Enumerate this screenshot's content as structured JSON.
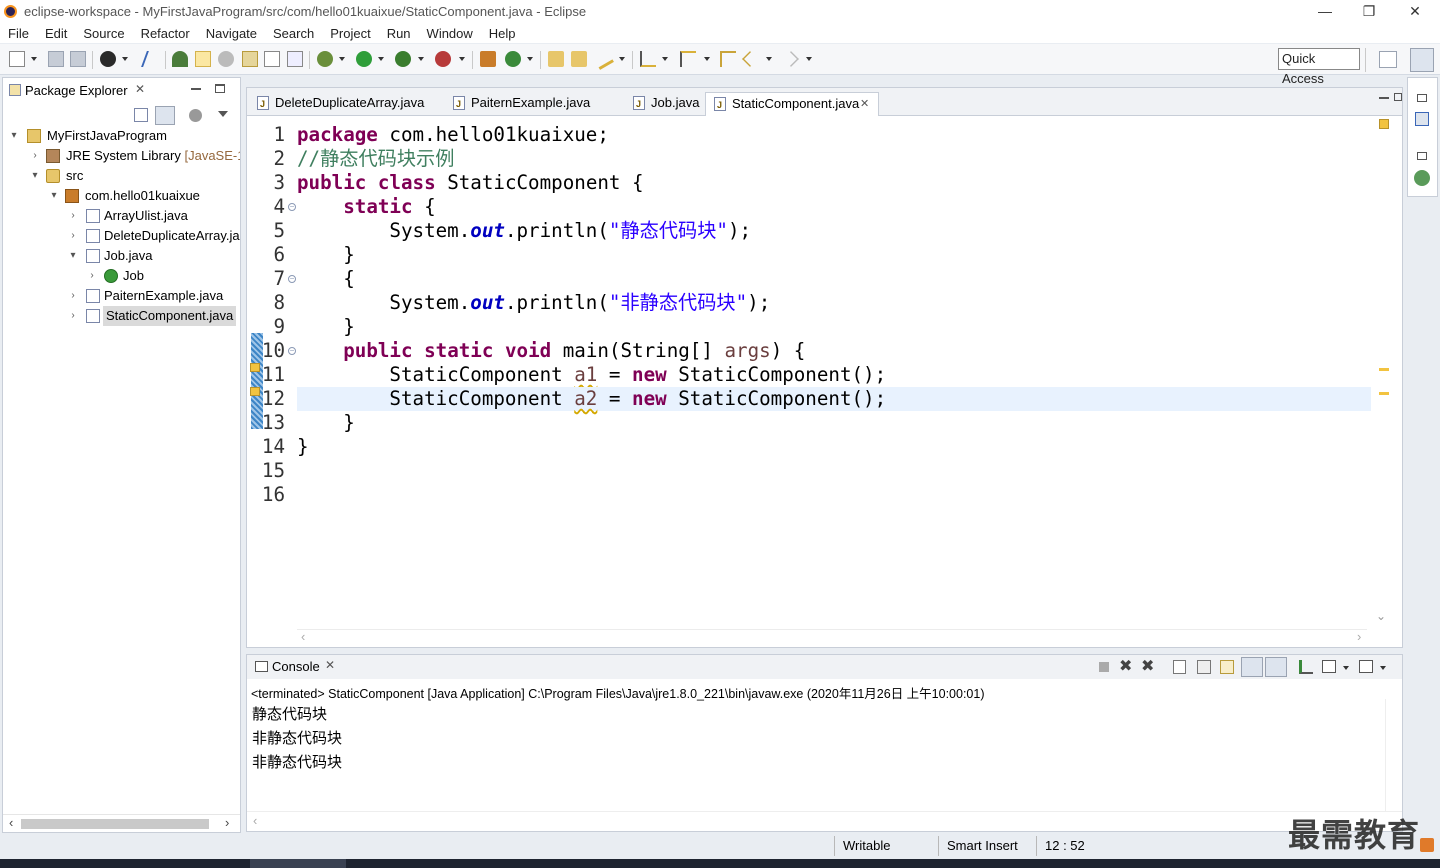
{
  "window": {
    "title": "eclipse-workspace - MyFirstJavaProgram/src/com/hello01kuaixue/StaticComponent.java - Eclipse",
    "minimize": "—",
    "restore": "❐",
    "close": "✕"
  },
  "menu": [
    "File",
    "Edit",
    "Source",
    "Refactor",
    "Navigate",
    "Search",
    "Project",
    "Run",
    "Window",
    "Help"
  ],
  "toolbar": {
    "quick_access": "Quick Access"
  },
  "package_explorer": {
    "title": "Package Explorer",
    "tree": [
      {
        "label": "MyFirstJavaProgram",
        "depth": 0,
        "twisty": "▾",
        "icon": "project-icon"
      },
      {
        "label": "JRE System Library",
        "suffix": " [JavaSE-1.",
        "depth": 1,
        "twisty": "›",
        "icon": "library-icon"
      },
      {
        "label": "src",
        "depth": 1,
        "twisty": "▾",
        "icon": "source-folder-icon"
      },
      {
        "label": "com.hello01kuaixue",
        "depth": 2,
        "twisty": "▾",
        "icon": "package-icon"
      },
      {
        "label": "ArrayUlist.java",
        "depth": 3,
        "twisty": "›",
        "icon": "java-file-icon"
      },
      {
        "label": "DeleteDuplicateArray.ja",
        "depth": 3,
        "twisty": "›",
        "icon": "java-file-icon"
      },
      {
        "label": "Job.java",
        "depth": 3,
        "twisty": "▾",
        "icon": "java-file-icon"
      },
      {
        "label": "Job",
        "depth": 4,
        "twisty": "›",
        "icon": "class-icon"
      },
      {
        "label": "PaiternExample.java",
        "depth": 3,
        "twisty": "›",
        "icon": "java-file-icon"
      },
      {
        "label": "StaticComponent.java",
        "depth": 3,
        "twisty": "›",
        "icon": "java-file-icon",
        "selected": true
      }
    ]
  },
  "editor": {
    "tabs": [
      {
        "label": "DeleteDuplicateArray.java",
        "active": false
      },
      {
        "label": "PaiternExample.java",
        "active": false
      },
      {
        "label": "Job.java",
        "active": false
      },
      {
        "label": "StaticComponent.java",
        "active": true
      }
    ],
    "close_glyph": "✕",
    "current_line": 12,
    "lines": [
      {
        "n": "1",
        "tokens": [
          {
            "t": "package",
            "k": "k"
          },
          {
            "t": " com.hello01kuaixue;",
            "k": "p"
          }
        ]
      },
      {
        "n": "2",
        "tokens": [
          {
            "t": "//静态代码块示例",
            "k": "c"
          }
        ]
      },
      {
        "n": "3",
        "tokens": [
          {
            "t": "public",
            "k": "k"
          },
          {
            "t": " ",
            "k": "p"
          },
          {
            "t": "class",
            "k": "k"
          },
          {
            "t": " StaticComponent {",
            "k": "p"
          }
        ]
      },
      {
        "n": "4",
        "fold": true,
        "tokens": [
          {
            "t": "    ",
            "k": "p"
          },
          {
            "t": "static",
            "k": "k"
          },
          {
            "t": " {",
            "k": "p"
          }
        ]
      },
      {
        "n": "5",
        "tokens": [
          {
            "t": "        System.",
            "k": "p"
          },
          {
            "t": "out",
            "k": "f"
          },
          {
            "t": ".println(",
            "k": "p"
          },
          {
            "t": "\"静态代码块\"",
            "k": "s"
          },
          {
            "t": ");",
            "k": "p"
          }
        ]
      },
      {
        "n": "6",
        "tokens": [
          {
            "t": "    }",
            "k": "p"
          }
        ]
      },
      {
        "n": "7",
        "fold": true,
        "tokens": [
          {
            "t": "    {",
            "k": "p"
          }
        ]
      },
      {
        "n": "8",
        "tokens": [
          {
            "t": "        System.",
            "k": "p"
          },
          {
            "t": "out",
            "k": "f"
          },
          {
            "t": ".println(",
            "k": "p"
          },
          {
            "t": "\"非静态代码块\"",
            "k": "s"
          },
          {
            "t": ");",
            "k": "p"
          }
        ]
      },
      {
        "n": "9",
        "tokens": [
          {
            "t": "    }",
            "k": "p"
          }
        ]
      },
      {
        "n": "10",
        "fold": true,
        "tokens": [
          {
            "t": "    ",
            "k": "p"
          },
          {
            "t": "public",
            "k": "k"
          },
          {
            "t": " ",
            "k": "p"
          },
          {
            "t": "static",
            "k": "k"
          },
          {
            "t": " ",
            "k": "p"
          },
          {
            "t": "void",
            "k": "k"
          },
          {
            "t": " main(String[] ",
            "k": "p"
          },
          {
            "t": "args",
            "k": "v"
          },
          {
            "t": ") {",
            "k": "p"
          }
        ]
      },
      {
        "n": "11",
        "warn": true,
        "tokens": [
          {
            "t": "        StaticComponent ",
            "k": "p"
          },
          {
            "t": "a1",
            "k": "v uw"
          },
          {
            "t": " = ",
            "k": "p"
          },
          {
            "t": "new",
            "k": "k"
          },
          {
            "t": " StaticComponent();",
            "k": "p"
          }
        ]
      },
      {
        "n": "12",
        "warn": true,
        "tokens": [
          {
            "t": "        StaticComponent ",
            "k": "p"
          },
          {
            "t": "a2",
            "k": "v uw"
          },
          {
            "t": " = ",
            "k": "p"
          },
          {
            "t": "new",
            "k": "k"
          },
          {
            "t": " StaticComponent();",
            "k": "p"
          }
        ]
      },
      {
        "n": "13",
        "tokens": [
          {
            "t": "    }",
            "k": "p"
          }
        ]
      },
      {
        "n": "14",
        "tokens": [
          {
            "t": "}",
            "k": "p"
          }
        ]
      },
      {
        "n": "15",
        "tokens": []
      },
      {
        "n": "16",
        "tokens": []
      }
    ]
  },
  "console": {
    "title": "Console",
    "terminated": "<terminated> StaticComponent [Java Application] C:\\Program Files\\Java\\jre1.8.0_221\\bin\\javaw.exe (2020年11月26日 上午10:00:01)",
    "output": [
      "静态代码块",
      "非静态代码块",
      "非静态代码块"
    ]
  },
  "status": {
    "writable": "Writable",
    "insert_mode": "Smart Insert",
    "position": "12 : 52"
  },
  "watermark": "最需教育",
  "colors": {
    "keyword": "#7f0055",
    "string": "#2a00ff",
    "comment": "#3f7f5f",
    "field": "#0000c0",
    "variable": "#6a3e3e",
    "current_line": "#e8f2fe"
  }
}
